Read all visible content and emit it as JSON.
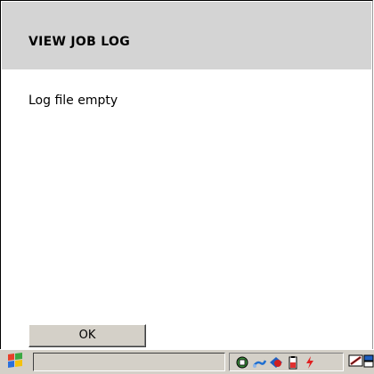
{
  "window": {
    "title": "VIEW JOB LOG"
  },
  "content": {
    "message": "Log file empty"
  },
  "buttons": {
    "ok_label": "OK"
  },
  "taskbar": {
    "task_field_value": "",
    "tray_icons": [
      "network-icon",
      "pen-icon",
      "connection-icon",
      "battery-icon",
      "power-icon"
    ],
    "system_icons": [
      "input-panel-icon",
      "desktop-switch-icon"
    ]
  },
  "colors": {
    "header_bg": "#d4d4d4",
    "taskbar_bg": "#d4d0c8"
  }
}
